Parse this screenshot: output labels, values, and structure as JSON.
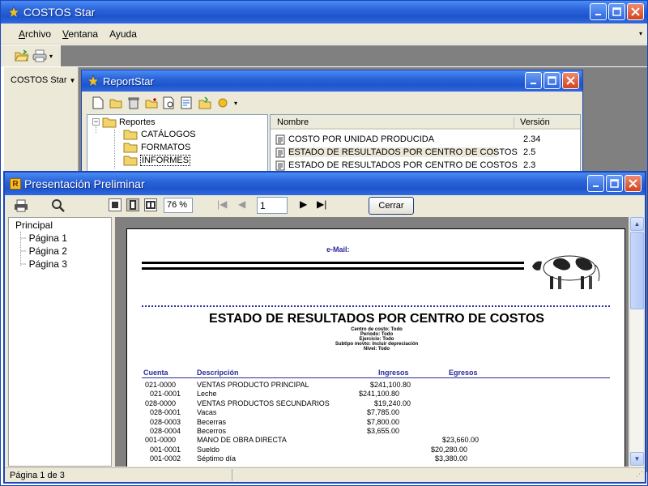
{
  "main_window": {
    "title": "COSTOS Star",
    "menu": [
      {
        "label": "Archivo",
        "key": "A",
        "rest": "rchivo"
      },
      {
        "label": "Ventana",
        "key": "V",
        "rest": "entana"
      },
      {
        "label": "Ayuda",
        "key": "",
        "rest": "Ayuda"
      }
    ],
    "side_panel_label": "COSTOS Star",
    "toolbar_icons": [
      "open-folder-icon",
      "print-icon"
    ]
  },
  "report_window": {
    "title": "ReportStar",
    "tree": {
      "root": "Reportes",
      "children": [
        "CATÁLOGOS",
        "FORMATOS",
        "INFORMES"
      ],
      "selected": "INFORMES"
    },
    "list": {
      "columns": [
        "Nombre",
        "Versión"
      ],
      "rows": [
        {
          "name": "COSTO POR UNIDAD PRODUCIDA",
          "version": "2.34"
        },
        {
          "name": "ESTADO DE RESULTADOS POR CENTRO DE COSTOS",
          "version": "2.5"
        },
        {
          "name": "ESTADO DE RESULTADOS POR CENTRO DE COSTOS (…",
          "version": "2.3"
        }
      ]
    }
  },
  "preview_window": {
    "title": "Presentación Preliminar",
    "zoom": "76 %",
    "page_input": "1",
    "close_label": "Cerrar",
    "outline": {
      "root": "Principal",
      "pages": [
        "Página 1",
        "Página 2",
        "Página 3"
      ]
    },
    "status": "Página 1 de 3"
  },
  "report": {
    "email_label": "e-Mail:",
    "title": "ESTADO DE RESULTADOS POR CENTRO DE COSTOS",
    "filters": [
      "Centro de costo: Todo",
      "Periodo: Todo",
      "Ejercicio: Todo",
      "Subtipo movto: Incluir depreciación",
      "Nivel: Todo"
    ],
    "headers": {
      "cuenta": "Cuenta",
      "descripcion": "Descripción",
      "ingresos": "Ingresos",
      "egresos": "Egresos"
    },
    "rows": [
      {
        "cuenta": "021-0000",
        "desc": "VENTAS PRODUCTO PRINCIPAL",
        "ing2": "$241,100.80",
        "ing1": "",
        "egr2": "",
        "egr1": ""
      },
      {
        "cuenta": "021-0001",
        "desc": "Leche",
        "ing2": "",
        "ing1": "$241,100.80",
        "egr2": "",
        "egr1": ""
      },
      {
        "cuenta": "028-0000",
        "desc": "VENTAS PRODUCTOS SECUNDARIOS",
        "ing2": "$19,240.00",
        "ing1": "",
        "egr2": "",
        "egr1": ""
      },
      {
        "cuenta": "028-0001",
        "desc": "Vacas",
        "ing2": "",
        "ing1": "$7,785.00",
        "egr2": "",
        "egr1": ""
      },
      {
        "cuenta": "028-0003",
        "desc": "Becerras",
        "ing2": "",
        "ing1": "$7,800.00",
        "egr2": "",
        "egr1": ""
      },
      {
        "cuenta": "028-0004",
        "desc": "Becerros",
        "ing2": "",
        "ing1": "$3,655.00",
        "egr2": "",
        "egr1": ""
      },
      {
        "cuenta": "001-0000",
        "desc": "MANO DE OBRA DIRECTA",
        "ing2": "",
        "ing1": "",
        "egr2": "$23,660.00",
        "egr1": ""
      },
      {
        "cuenta": "001-0001",
        "desc": "Sueldo",
        "ing2": "",
        "ing1": "",
        "egr2": "",
        "egr1": "$20,280.00"
      },
      {
        "cuenta": "001-0002",
        "desc": "Séptimo día",
        "ing2": "",
        "ing1": "",
        "egr2": "",
        "egr1": "$3,380.00"
      }
    ]
  }
}
